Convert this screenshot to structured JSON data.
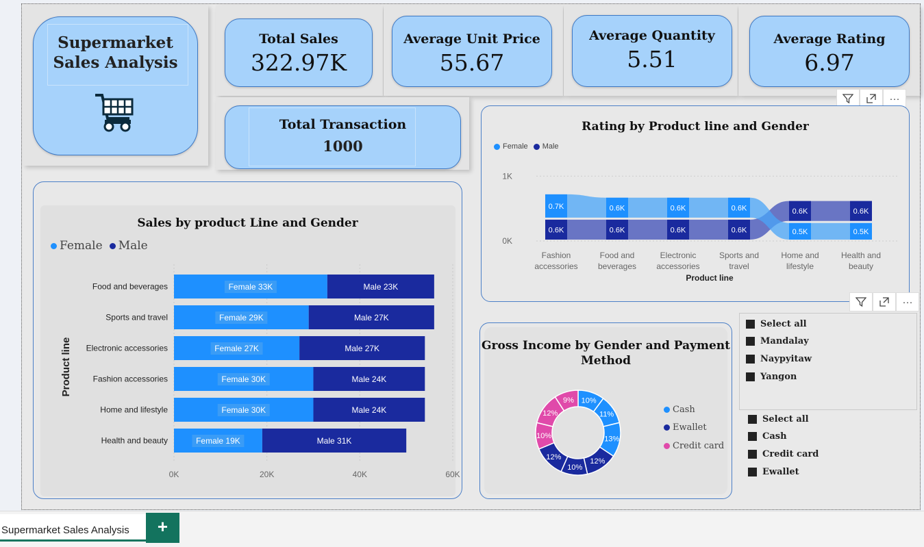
{
  "header": {
    "title_line1": "Supermarket",
    "title_line2": "Sales Analysis"
  },
  "kpis": {
    "total_sales": {
      "label": "Total Sales",
      "value": "322.97K"
    },
    "avg_unit_price": {
      "label": "Average Unit Price",
      "value": "55.67"
    },
    "avg_quantity": {
      "label": "Average Quantity",
      "value": "5.51"
    },
    "avg_rating": {
      "label": "Average Rating",
      "value": "6.97"
    },
    "total_transaction": {
      "label": "Total Transaction",
      "value": "1000"
    }
  },
  "toolbar": {
    "filter_icon": "filter-icon",
    "focus_icon": "focus-mode-icon",
    "more_icon": "more-options-icon",
    "more_label": "···"
  },
  "colors": {
    "female": "#1e90ff",
    "male": "#1a2a9e",
    "credit": "#e04aaa"
  },
  "chart_data": [
    {
      "type": "bar",
      "orientation": "horizontal-stacked",
      "title": "Sales by product Line and Gender",
      "ylabel": "Product line",
      "legend": [
        "Female",
        "Male"
      ],
      "categories": [
        "Food and beverages",
        "Sports and travel",
        "Electronic accessories",
        "Fashion accessories",
        "Home and lifestyle",
        "Health and beauty"
      ],
      "series": [
        {
          "name": "Female",
          "values": [
            33,
            29,
            27,
            30,
            30,
            19
          ],
          "labels": [
            "Female 33K",
            "Female 29K",
            "Female 27K",
            "Female 30K",
            "Female 30K",
            "Female 19K"
          ]
        },
        {
          "name": "Male",
          "values": [
            23,
            27,
            27,
            24,
            24,
            31
          ],
          "labels": [
            "Male 23K",
            "Male 27K",
            "Male 27K",
            "Male 24K",
            "Male 24K",
            "Male 31K"
          ]
        }
      ],
      "xticks": [
        "0K",
        "20K",
        "40K",
        "60K"
      ],
      "xlim": [
        0,
        60
      ]
    },
    {
      "type": "bar",
      "orientation": "ribbon-stacked",
      "title": "Rating by Product line and Gender",
      "xlabel": "Product line",
      "legend": [
        "Female",
        "Male"
      ],
      "categories": [
        [
          "Fashion",
          "accessories"
        ],
        [
          "Food and",
          "beverages"
        ],
        [
          "Electronic",
          "accessories"
        ],
        [
          "Sports and",
          "travel"
        ],
        [
          "Home and",
          "lifestyle"
        ],
        [
          "Health and",
          "beauty"
        ]
      ],
      "series": [
        {
          "name": "Female",
          "values": [
            0.7,
            0.6,
            0.6,
            0.6,
            0.5,
            0.5
          ],
          "labels": [
            "0.7K",
            "0.6K",
            "0.6K",
            "0.6K",
            "0.5K",
            "0.5K"
          ]
        },
        {
          "name": "Male",
          "values": [
            0.6,
            0.6,
            0.6,
            0.6,
            0.6,
            0.6
          ],
          "labels": [
            "0.6K",
            "0.6K",
            "0.6K",
            "0.6K",
            "0.6K",
            "0.6K"
          ]
        }
      ],
      "yticks": [
        "0K",
        "1K"
      ],
      "ylim": [
        0,
        1.4
      ]
    },
    {
      "type": "pie",
      "variant": "donut",
      "title_line1": "Gross Income by Gender and Payment",
      "title_line2": "Method",
      "legend": [
        "Cash",
        "Ewallet",
        "Credit card"
      ],
      "slices": [
        {
          "label": "10%",
          "value": 10,
          "group": "Cash",
          "color": "#1e90ff"
        },
        {
          "label": "11%",
          "value": 11,
          "group": "Cash",
          "color": "#1e90ff"
        },
        {
          "label": "13%",
          "value": 13,
          "group": "Cash",
          "color": "#1e90ff"
        },
        {
          "label": "12%",
          "value": 12,
          "group": "Ewallet",
          "color": "#1a2a9e"
        },
        {
          "label": "10%",
          "value": 10,
          "group": "Ewallet",
          "color": "#1a2a9e"
        },
        {
          "label": "12%",
          "value": 12,
          "group": "Ewallet",
          "color": "#1a2a9e"
        },
        {
          "label": "10%",
          "value": 10,
          "group": "Credit card",
          "color": "#e04aaa"
        },
        {
          "label": "12%",
          "value": 12,
          "group": "Credit card",
          "color": "#e04aaa"
        },
        {
          "label": "9%",
          "value": 9,
          "group": "Credit card",
          "color": "#e04aaa"
        }
      ]
    }
  ],
  "slicer_city": [
    "Select all",
    "Mandalay",
    "Naypyitaw",
    "Yangon"
  ],
  "slicer_payment": [
    "Select all",
    "Cash",
    "Credit card",
    "Ewallet"
  ],
  "tabs": {
    "active": "Supermarket Sales Analysis",
    "add_label": "+"
  }
}
